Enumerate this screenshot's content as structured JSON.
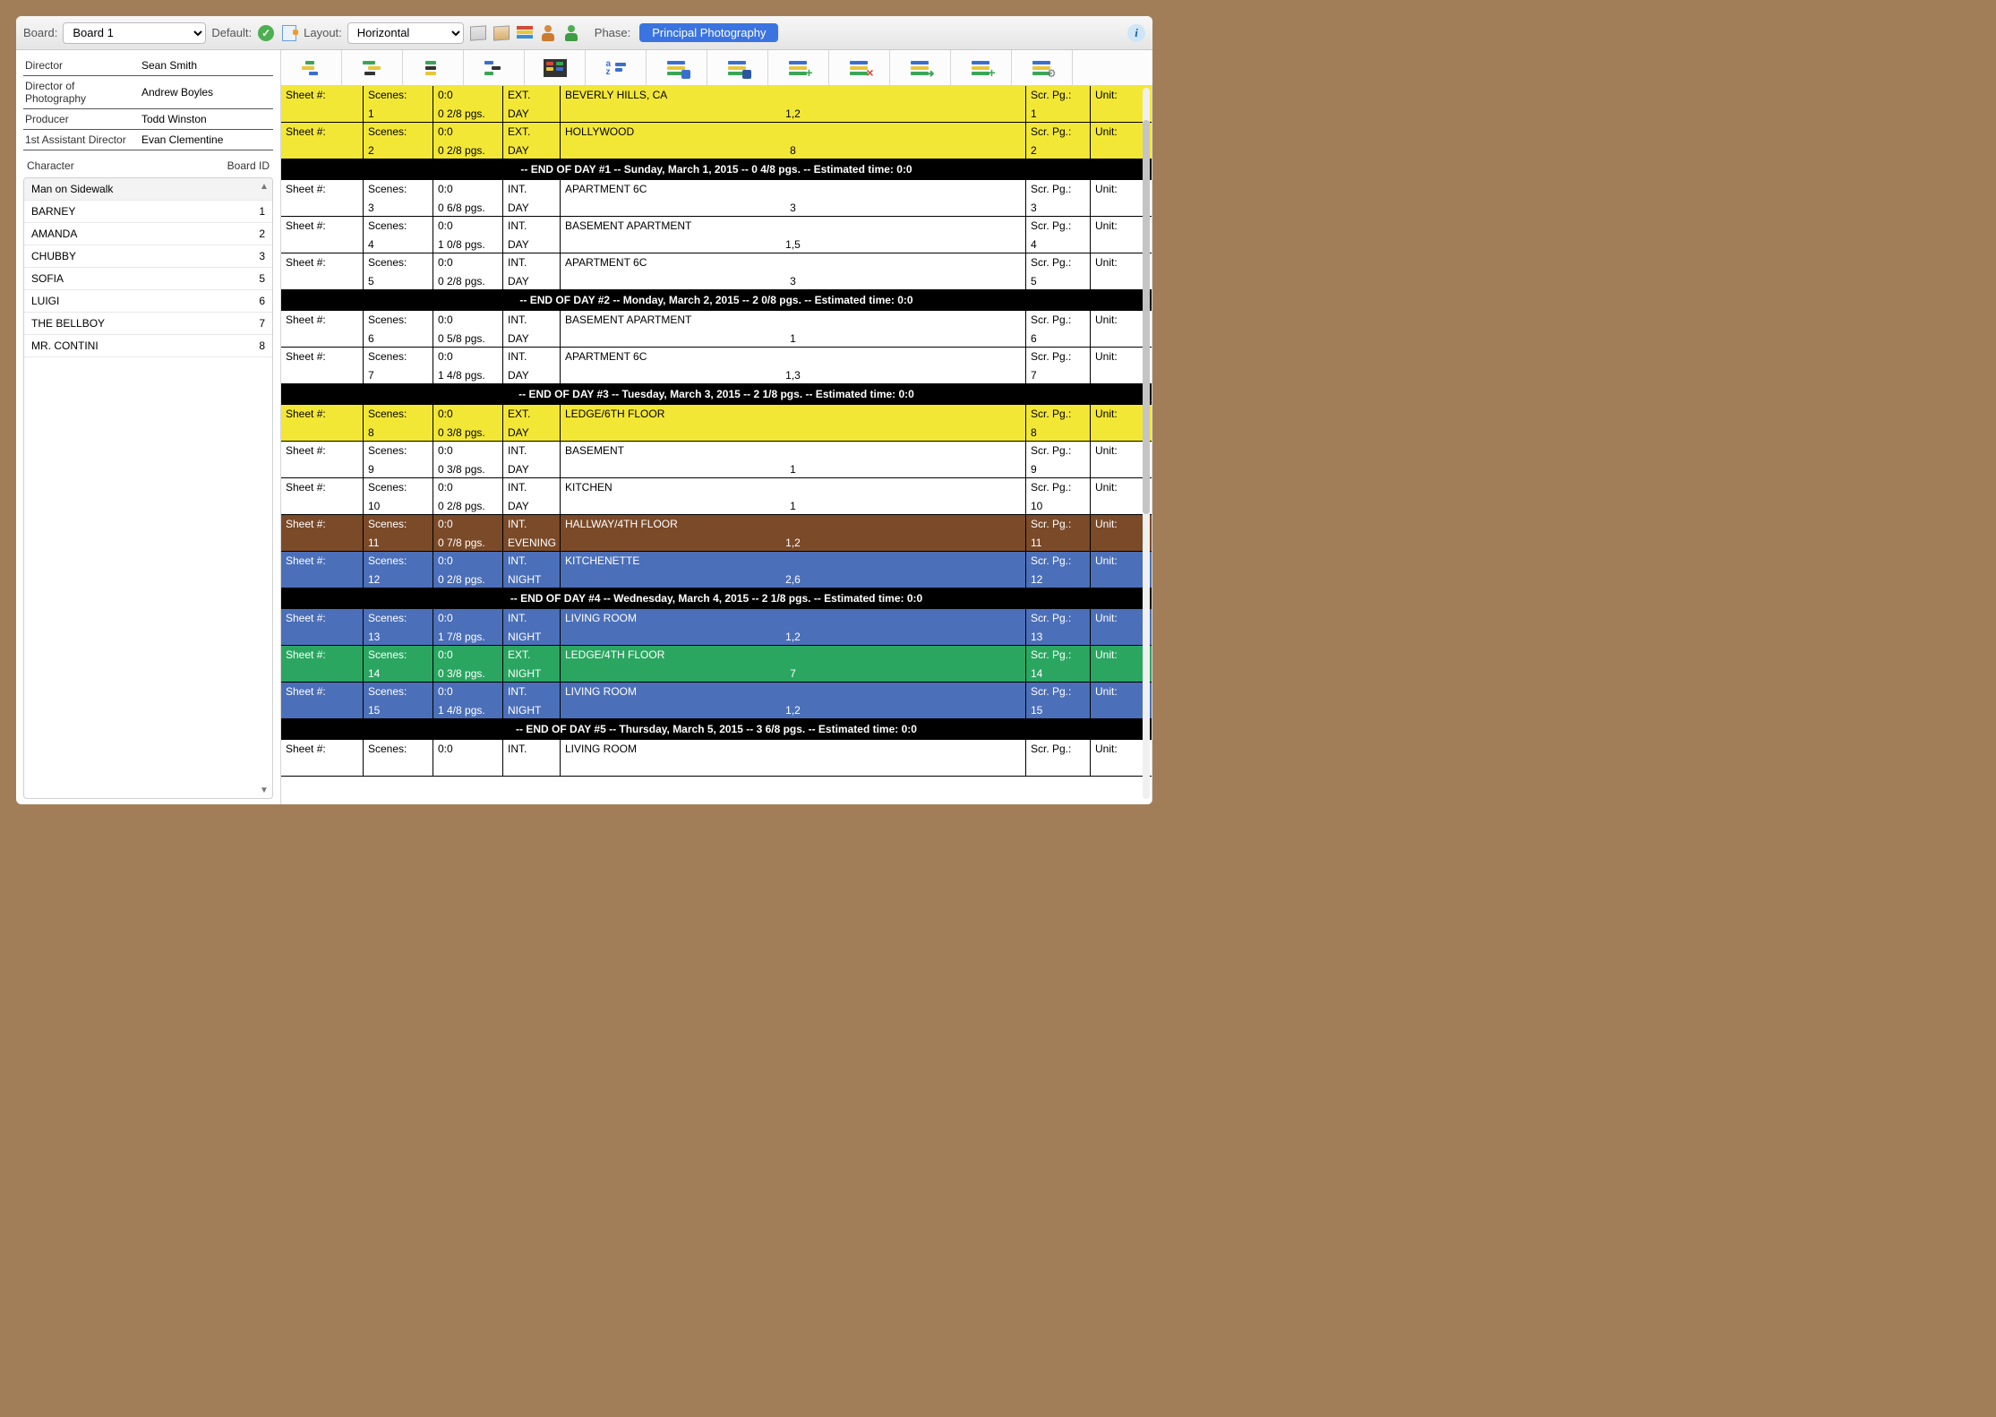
{
  "toolbar": {
    "board_label": "Board:",
    "board_value": "Board 1",
    "default_label": "Default:",
    "layout_label": "Layout:",
    "layout_value": "Horizontal",
    "phase_label": "Phase:",
    "phase_value": "Principal Photography"
  },
  "crew": [
    {
      "role": "Director",
      "name": "Sean Smith"
    },
    {
      "role": "Director of Photography",
      "name": "Andrew Boyles"
    },
    {
      "role": "Producer",
      "name": "Todd Winston"
    },
    {
      "role": "1st Assistant Director",
      "name": "Evan Clementine"
    }
  ],
  "char_header": {
    "left": "Character",
    "right": "Board ID"
  },
  "characters": [
    {
      "name": "Man on Sidewalk",
      "id": ""
    },
    {
      "name": "BARNEY",
      "id": "1"
    },
    {
      "name": "AMANDA",
      "id": "2"
    },
    {
      "name": "CHUBBY",
      "id": "3"
    },
    {
      "name": "SOFIA",
      "id": "5"
    },
    {
      "name": "LUIGI",
      "id": "6"
    },
    {
      "name": "THE BELLBOY",
      "id": "7"
    },
    {
      "name": "MR. CONTINI",
      "id": "8"
    }
  ],
  "column_labels": {
    "sheet": "Sheet #:",
    "scenes": "Scenes:",
    "scrpg": "Scr. Pg.:",
    "unit": "Unit:"
  },
  "rows": [
    {
      "type": "strip",
      "color": "yellow",
      "scene": "1",
      "time": "0:0",
      "pages": "0 2/8 pgs.",
      "ie": "EXT.",
      "tod": "DAY",
      "loc": "BEVERLY HILLS, CA",
      "cast": "1,2",
      "pg": "1"
    },
    {
      "type": "strip",
      "color": "yellow",
      "scene": "2",
      "time": "0:0",
      "pages": "0 2/8 pgs.",
      "ie": "EXT.",
      "tod": "DAY",
      "loc": "HOLLYWOOD",
      "cast": "8",
      "pg": "2"
    },
    {
      "type": "break",
      "text": "-- END OF DAY #1 -- Sunday, March 1, 2015 -- 0 4/8 pgs. -- Estimated time: 0:0"
    },
    {
      "type": "strip",
      "color": "white",
      "scene": "3",
      "time": "0:0",
      "pages": "0 6/8 pgs.",
      "ie": "INT.",
      "tod": "DAY",
      "loc": "APARTMENT 6C",
      "cast": "3",
      "pg": "3"
    },
    {
      "type": "strip",
      "color": "white",
      "scene": "4",
      "time": "0:0",
      "pages": "1 0/8 pgs.",
      "ie": "INT.",
      "tod": "DAY",
      "loc": "BASEMENT APARTMENT",
      "cast": "1,5",
      "pg": "4"
    },
    {
      "type": "strip",
      "color": "white",
      "scene": "5",
      "time": "0:0",
      "pages": "0 2/8 pgs.",
      "ie": "INT.",
      "tod": "DAY",
      "loc": "APARTMENT 6C",
      "cast": "3",
      "pg": "5"
    },
    {
      "type": "break",
      "text": "-- END OF DAY #2 -- Monday, March 2, 2015 -- 2 0/8 pgs. -- Estimated time: 0:0"
    },
    {
      "type": "strip",
      "color": "white",
      "scene": "6",
      "time": "0:0",
      "pages": "0 5/8 pgs.",
      "ie": "INT.",
      "tod": "DAY",
      "loc": "BASEMENT APARTMENT",
      "cast": "1",
      "pg": "6"
    },
    {
      "type": "strip",
      "color": "white",
      "scene": "7",
      "time": "0:0",
      "pages": "1 4/8 pgs.",
      "ie": "INT.",
      "tod": "DAY",
      "loc": "APARTMENT 6C",
      "cast": "1,3",
      "pg": "7"
    },
    {
      "type": "break",
      "text": "-- END OF DAY #3 -- Tuesday, March 3, 2015 -- 2 1/8 pgs. -- Estimated time: 0:0"
    },
    {
      "type": "strip",
      "color": "yellow",
      "scene": "8",
      "time": "0:0",
      "pages": "0 3/8 pgs.",
      "ie": "EXT.",
      "tod": "DAY",
      "loc": "LEDGE/6TH FLOOR",
      "cast": "",
      "pg": "8"
    },
    {
      "type": "strip",
      "color": "white",
      "scene": "9",
      "time": "0:0",
      "pages": "0 3/8 pgs.",
      "ie": "INT.",
      "tod": "DAY",
      "loc": "BASEMENT",
      "cast": "1",
      "pg": "9"
    },
    {
      "type": "strip",
      "color": "white",
      "scene": "10",
      "time": "0:0",
      "pages": "0 2/8 pgs.",
      "ie": "INT.",
      "tod": "DAY",
      "loc": "KITCHEN",
      "cast": "1",
      "pg": "10"
    },
    {
      "type": "strip",
      "color": "brown",
      "scene": "11",
      "time": "0:0",
      "pages": "0 7/8 pgs.",
      "ie": "INT.",
      "tod": "EVENING",
      "loc": "HALLWAY/4TH FLOOR",
      "cast": "1,2",
      "pg": "11"
    },
    {
      "type": "strip",
      "color": "blue",
      "scene": "12",
      "time": "0:0",
      "pages": "0 2/8 pgs.",
      "ie": "INT.",
      "tod": "NIGHT",
      "loc": "KITCHENETTE",
      "cast": "2,6",
      "pg": "12"
    },
    {
      "type": "break",
      "text": "-- END OF DAY #4 -- Wednesday, March 4, 2015 -- 2 1/8 pgs. -- Estimated time: 0:0"
    },
    {
      "type": "strip",
      "color": "blue",
      "scene": "13",
      "time": "0:0",
      "pages": "1 7/8 pgs.",
      "ie": "INT.",
      "tod": "NIGHT",
      "loc": "LIVING ROOM",
      "cast": "1,2",
      "pg": "13"
    },
    {
      "type": "strip",
      "color": "green",
      "scene": "14",
      "time": "0:0",
      "pages": "0 3/8 pgs.",
      "ie": "EXT.",
      "tod": "NIGHT",
      "loc": "LEDGE/4TH FLOOR",
      "cast": "7",
      "pg": "14"
    },
    {
      "type": "strip",
      "color": "blue",
      "scene": "15",
      "time": "0:0",
      "pages": "1 4/8 pgs.",
      "ie": "INT.",
      "tod": "NIGHT",
      "loc": "LIVING ROOM",
      "cast": "1,2",
      "pg": "15"
    },
    {
      "type": "break",
      "text": "-- END OF DAY #5 -- Thursday, March 5, 2015 -- 3 6/8 pgs. -- Estimated time: 0:0"
    },
    {
      "type": "strip",
      "color": "white",
      "scene": "",
      "time": "0:0",
      "pages": "",
      "ie": "INT.",
      "tod": "",
      "loc": "LIVING ROOM",
      "cast": "",
      "pg": ""
    }
  ]
}
